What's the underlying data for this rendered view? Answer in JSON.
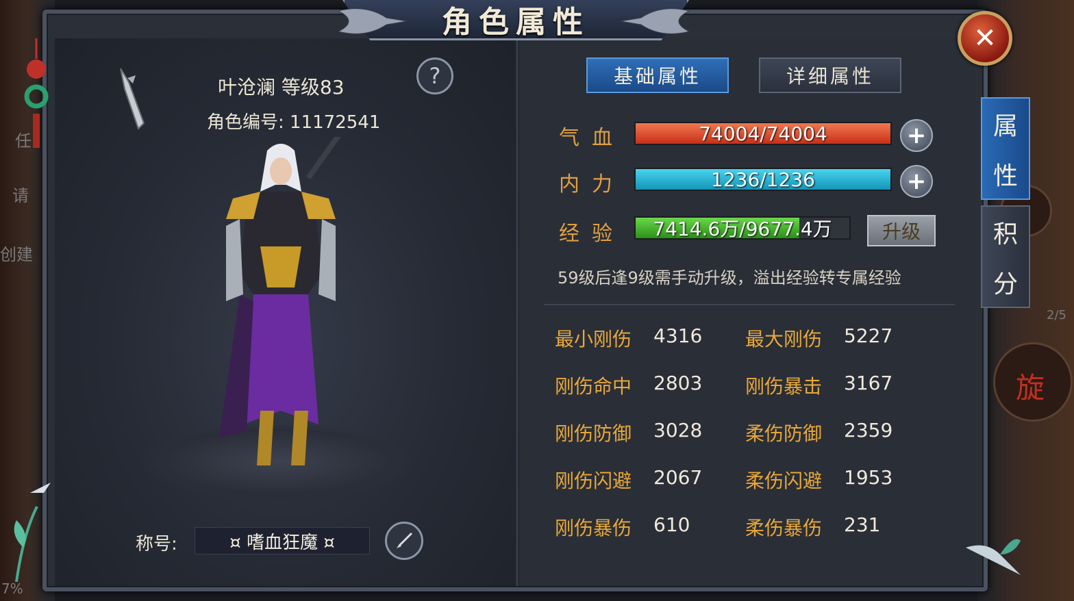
{
  "window": {
    "title": "角色属性"
  },
  "character": {
    "name_level": "叶沧澜 等级83",
    "id_line": "角色编号: 11172541",
    "title_label": "称号:",
    "title_value": "¤ 嗜血狂魔 ¤"
  },
  "tabs": [
    {
      "label": "基础属性",
      "active": true
    },
    {
      "label": "详细属性",
      "active": false
    }
  ],
  "bars": {
    "hp": {
      "label": "气血",
      "text": "74004/74004",
      "current": 74004,
      "max": 74004,
      "color": "#e04a28"
    },
    "mp": {
      "label": "内力",
      "text": "1236/1236",
      "current": 1236,
      "max": 1236,
      "color": "#1fb4d8"
    },
    "exp": {
      "label": "经验",
      "text": "7414.6万/9677.4万",
      "fraction": 0.766,
      "color": "#44b42a"
    }
  },
  "upgrade_label": "升级",
  "note": "59级后逢9级需手动升级，溢出经验转专属经验",
  "attributes": [
    {
      "name": "最小刚伤",
      "value": "4316"
    },
    {
      "name": "最大刚伤",
      "value": "5227"
    },
    {
      "name": "刚伤命中",
      "value": "2803"
    },
    {
      "name": "刚伤暴击",
      "value": "3167"
    },
    {
      "name": "刚伤防御",
      "value": "3028"
    },
    {
      "name": "柔伤防御",
      "value": "2359"
    },
    {
      "name": "刚伤闪避",
      "value": "2067"
    },
    {
      "name": "柔伤闪避",
      "value": "1953"
    },
    {
      "name": "刚伤暴伤",
      "value": "610"
    },
    {
      "name": "柔伤暴伤",
      "value": "231"
    }
  ],
  "side_tabs": [
    {
      "chars": [
        "属",
        "性"
      ],
      "active": true
    },
    {
      "chars": [
        "积",
        "分"
      ],
      "active": false
    }
  ],
  "background": {
    "left_texts": [
      "任",
      "请",
      "创建"
    ],
    "right_texts": [
      "旋",
      "2/5"
    ],
    "bottom_left": "7%"
  },
  "icons": {
    "close": "close-icon",
    "help": "question-icon",
    "edit": "brush-icon",
    "plus": "plus-icon",
    "weapon": "sword-icon"
  }
}
